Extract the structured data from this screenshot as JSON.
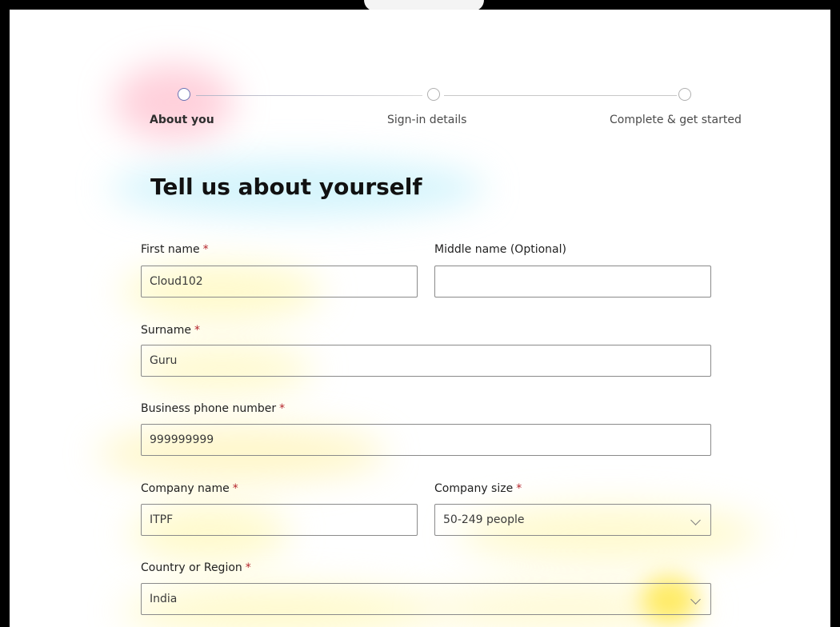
{
  "stepper": {
    "steps": [
      {
        "label": "About you",
        "active": true
      },
      {
        "label": "Sign-in details",
        "active": false
      },
      {
        "label": "Complete & get started",
        "active": false
      }
    ]
  },
  "page": {
    "title": "Tell us about yourself",
    "required_marker": "*"
  },
  "form": {
    "first_name": {
      "label": "First name",
      "value": "Cloud102",
      "required": true
    },
    "middle_name": {
      "label": "Middle name (Optional)",
      "value": "",
      "required": false
    },
    "surname": {
      "label": "Surname",
      "value": "Guru",
      "required": true
    },
    "phone": {
      "label": "Business phone number",
      "value": "999999999",
      "required": true
    },
    "company_name": {
      "label": "Company name",
      "value": "ITPF",
      "required": true
    },
    "company_size": {
      "label": "Company size",
      "value": "50-249 people",
      "required": true
    },
    "country": {
      "label": "Country or Region",
      "value": "India",
      "required": true
    }
  },
  "colors": {
    "active_step": "#6a73b3",
    "required": "#b4232a",
    "border": "#8a8a8a"
  }
}
